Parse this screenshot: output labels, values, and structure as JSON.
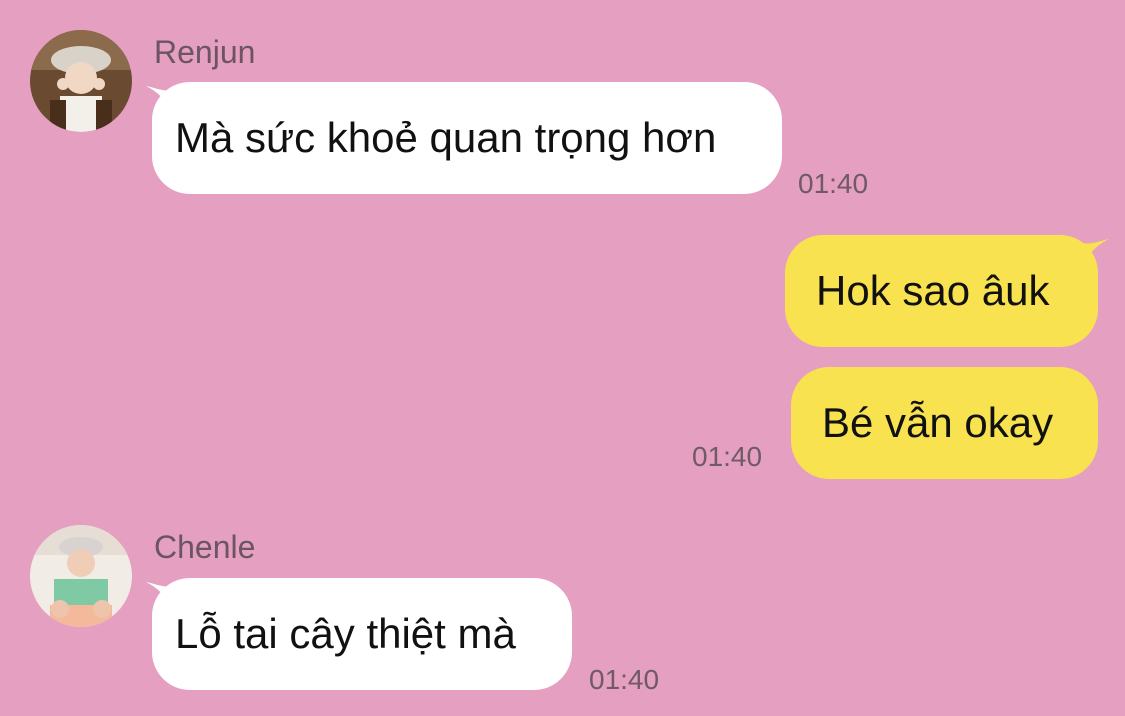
{
  "colors": {
    "background": "#e59fc1",
    "incoming_bubble": "#ffffff",
    "outgoing_bubble": "#f8e24f",
    "timestamp_text": "#6f5a66",
    "sender_text": "#6b5563"
  },
  "messages": [
    {
      "sender": "Renjun",
      "direction": "incoming",
      "avatar": "renjun-avatar",
      "text": "Mà sức khoẻ quan trọng hơn",
      "time": "01:40"
    },
    {
      "direction": "outgoing",
      "text": "Hok sao âuk"
    },
    {
      "direction": "outgoing",
      "text": "Bé vẫn okay",
      "time": "01:40"
    },
    {
      "sender": "Chenle",
      "direction": "incoming",
      "avatar": "chenle-avatar",
      "text": "Lỗ tai cây thiệt mà",
      "time": "01:40"
    }
  ]
}
